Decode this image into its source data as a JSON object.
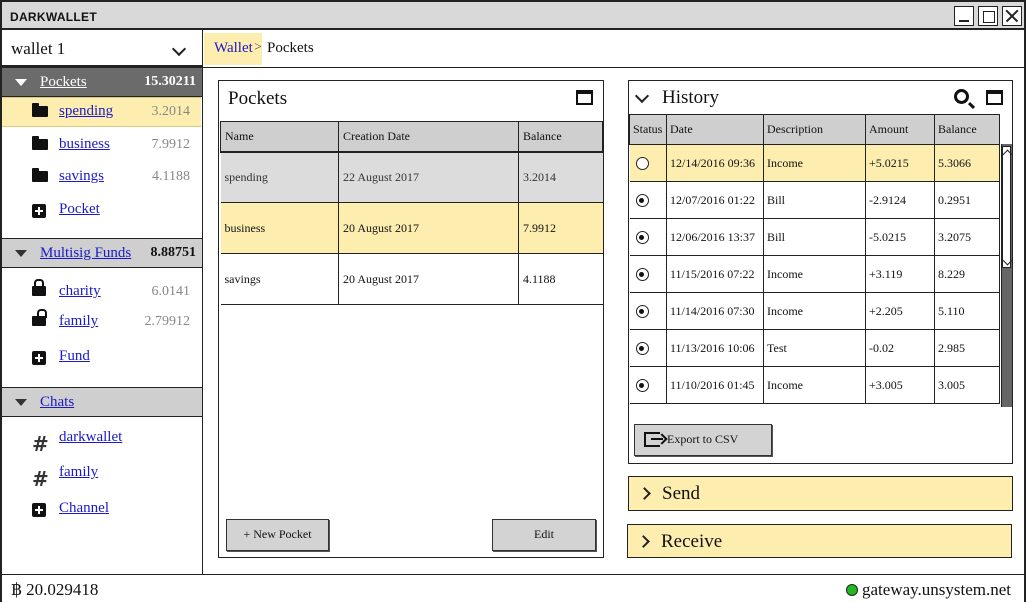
{
  "window": {
    "title": "DARKWALLET"
  },
  "wallet_selector": {
    "value": "wallet 1"
  },
  "sidebar": {
    "pockets": {
      "label": "Pockets",
      "total": "15.30211",
      "items": [
        {
          "label": "spending",
          "value": "3.2014",
          "icon": "folder-icon"
        },
        {
          "label": "business",
          "value": "7.9912",
          "icon": "folder-icon"
        },
        {
          "label": "savings",
          "value": "4.1188",
          "icon": "folder-icon"
        }
      ],
      "add_label": "Pocket"
    },
    "multisig": {
      "label": "Multisig Funds",
      "total": "8.88751",
      "items": [
        {
          "label": "charity",
          "value": "6.0141",
          "icon": "lock-icon"
        },
        {
          "label": "family",
          "value": "2.79912",
          "icon": "unlock-icon"
        }
      ],
      "add_label": "Fund"
    },
    "chats": {
      "label": "Chats",
      "items": [
        {
          "label": "darkwallet",
          "icon": "hash-icon"
        },
        {
          "label": "family",
          "icon": "hash-icon"
        }
      ],
      "add_label": "Channel"
    }
  },
  "breadcrumb": {
    "root": "Wallet",
    "separator": ">",
    "current": "Pockets"
  },
  "pockets_panel": {
    "title": "Pockets",
    "columns": [
      "Name",
      "Creation Date",
      "Balance"
    ],
    "rows": [
      {
        "name": "spending",
        "date": "22 August 2017",
        "balance": "3.2014"
      },
      {
        "name": "business",
        "date": "20 August 2017",
        "balance": "7.9912"
      },
      {
        "name": "savings",
        "date": "20 August 2017",
        "balance": "4.1188"
      }
    ],
    "new_button": "+ New Pocket",
    "edit_button": "Edit"
  },
  "history_panel": {
    "title": "History",
    "columns": [
      "Status",
      "Date",
      "Description",
      "Amount",
      "Balance"
    ],
    "rows": [
      {
        "date": "12/14/2016 09:36",
        "description": "Income",
        "amount": "+5.0215",
        "balance": "5.3066"
      },
      {
        "date": "12/07/2016 01:22",
        "description": "Bill",
        "amount": "-2.9124",
        "balance": "0.2951"
      },
      {
        "date": "12/06/2016 13:37",
        "description": "Bill",
        "amount": "-5.0215",
        "balance": "3.2075"
      },
      {
        "date": "11/15/2016 07:22",
        "description": "Income",
        "amount": "+3.119",
        "balance": "8.229"
      },
      {
        "date": "11/14/2016 07:30",
        "description": "Income",
        "amount": "+2.205",
        "balance": "5.110"
      },
      {
        "date": "11/13/2016 10:06",
        "description": "Test",
        "amount": "-0.02",
        "balance": "2.985"
      },
      {
        "date": "11/10/2016 01:45",
        "description": "Income",
        "amount": "+3.005",
        "balance": "3.005"
      }
    ],
    "export_button": "Export to CSV"
  },
  "send_panel": {
    "title": "Send"
  },
  "receive_panel": {
    "title": "Receive"
  },
  "status_bar": {
    "balance": "฿ 20.029418",
    "gateway": "gateway.unsystem.net",
    "connection_color": "#22b822"
  },
  "colors": {
    "highlight": "#fdeeb0",
    "header_gray": "#cfcfcf",
    "dark_header": "#6b6b6b",
    "link": "#1a1ac8"
  }
}
